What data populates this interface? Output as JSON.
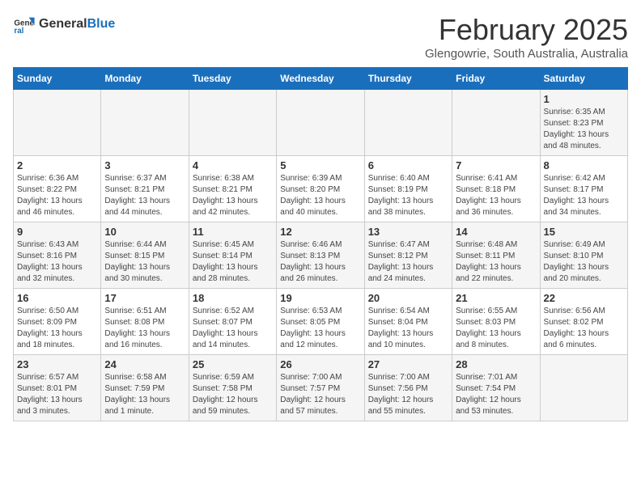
{
  "header": {
    "logo_line1": "General",
    "logo_line2": "Blue",
    "month": "February 2025",
    "location": "Glengowrie, South Australia, Australia"
  },
  "weekdays": [
    "Sunday",
    "Monday",
    "Tuesday",
    "Wednesday",
    "Thursday",
    "Friday",
    "Saturday"
  ],
  "weeks": [
    [
      {
        "day": "",
        "detail": ""
      },
      {
        "day": "",
        "detail": ""
      },
      {
        "day": "",
        "detail": ""
      },
      {
        "day": "",
        "detail": ""
      },
      {
        "day": "",
        "detail": ""
      },
      {
        "day": "",
        "detail": ""
      },
      {
        "day": "1",
        "detail": "Sunrise: 6:35 AM\nSunset: 8:23 PM\nDaylight: 13 hours\nand 48 minutes."
      }
    ],
    [
      {
        "day": "2",
        "detail": "Sunrise: 6:36 AM\nSunset: 8:22 PM\nDaylight: 13 hours\nand 46 minutes."
      },
      {
        "day": "3",
        "detail": "Sunrise: 6:37 AM\nSunset: 8:21 PM\nDaylight: 13 hours\nand 44 minutes."
      },
      {
        "day": "4",
        "detail": "Sunrise: 6:38 AM\nSunset: 8:21 PM\nDaylight: 13 hours\nand 42 minutes."
      },
      {
        "day": "5",
        "detail": "Sunrise: 6:39 AM\nSunset: 8:20 PM\nDaylight: 13 hours\nand 40 minutes."
      },
      {
        "day": "6",
        "detail": "Sunrise: 6:40 AM\nSunset: 8:19 PM\nDaylight: 13 hours\nand 38 minutes."
      },
      {
        "day": "7",
        "detail": "Sunrise: 6:41 AM\nSunset: 8:18 PM\nDaylight: 13 hours\nand 36 minutes."
      },
      {
        "day": "8",
        "detail": "Sunrise: 6:42 AM\nSunset: 8:17 PM\nDaylight: 13 hours\nand 34 minutes."
      }
    ],
    [
      {
        "day": "9",
        "detail": "Sunrise: 6:43 AM\nSunset: 8:16 PM\nDaylight: 13 hours\nand 32 minutes."
      },
      {
        "day": "10",
        "detail": "Sunrise: 6:44 AM\nSunset: 8:15 PM\nDaylight: 13 hours\nand 30 minutes."
      },
      {
        "day": "11",
        "detail": "Sunrise: 6:45 AM\nSunset: 8:14 PM\nDaylight: 13 hours\nand 28 minutes."
      },
      {
        "day": "12",
        "detail": "Sunrise: 6:46 AM\nSunset: 8:13 PM\nDaylight: 13 hours\nand 26 minutes."
      },
      {
        "day": "13",
        "detail": "Sunrise: 6:47 AM\nSunset: 8:12 PM\nDaylight: 13 hours\nand 24 minutes."
      },
      {
        "day": "14",
        "detail": "Sunrise: 6:48 AM\nSunset: 8:11 PM\nDaylight: 13 hours\nand 22 minutes."
      },
      {
        "day": "15",
        "detail": "Sunrise: 6:49 AM\nSunset: 8:10 PM\nDaylight: 13 hours\nand 20 minutes."
      }
    ],
    [
      {
        "day": "16",
        "detail": "Sunrise: 6:50 AM\nSunset: 8:09 PM\nDaylight: 13 hours\nand 18 minutes."
      },
      {
        "day": "17",
        "detail": "Sunrise: 6:51 AM\nSunset: 8:08 PM\nDaylight: 13 hours\nand 16 minutes."
      },
      {
        "day": "18",
        "detail": "Sunrise: 6:52 AM\nSunset: 8:07 PM\nDaylight: 13 hours\nand 14 minutes."
      },
      {
        "day": "19",
        "detail": "Sunrise: 6:53 AM\nSunset: 8:05 PM\nDaylight: 13 hours\nand 12 minutes."
      },
      {
        "day": "20",
        "detail": "Sunrise: 6:54 AM\nSunset: 8:04 PM\nDaylight: 13 hours\nand 10 minutes."
      },
      {
        "day": "21",
        "detail": "Sunrise: 6:55 AM\nSunset: 8:03 PM\nDaylight: 13 hours\nand 8 minutes."
      },
      {
        "day": "22",
        "detail": "Sunrise: 6:56 AM\nSunset: 8:02 PM\nDaylight: 13 hours\nand 6 minutes."
      }
    ],
    [
      {
        "day": "23",
        "detail": "Sunrise: 6:57 AM\nSunset: 8:01 PM\nDaylight: 13 hours\nand 3 minutes."
      },
      {
        "day": "24",
        "detail": "Sunrise: 6:58 AM\nSunset: 7:59 PM\nDaylight: 13 hours\nand 1 minute."
      },
      {
        "day": "25",
        "detail": "Sunrise: 6:59 AM\nSunset: 7:58 PM\nDaylight: 12 hours\nand 59 minutes."
      },
      {
        "day": "26",
        "detail": "Sunrise: 7:00 AM\nSunset: 7:57 PM\nDaylight: 12 hours\nand 57 minutes."
      },
      {
        "day": "27",
        "detail": "Sunrise: 7:00 AM\nSunset: 7:56 PM\nDaylight: 12 hours\nand 55 minutes."
      },
      {
        "day": "28",
        "detail": "Sunrise: 7:01 AM\nSunset: 7:54 PM\nDaylight: 12 hours\nand 53 minutes."
      },
      {
        "day": "",
        "detail": ""
      }
    ]
  ]
}
